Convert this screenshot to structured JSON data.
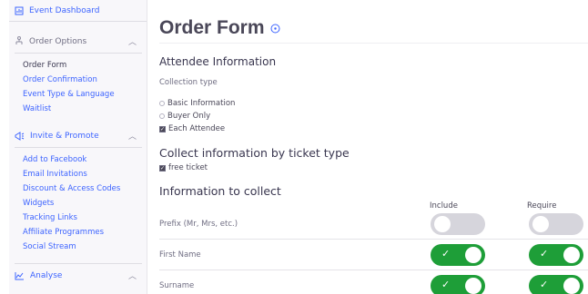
{
  "sidebar": {
    "top_item": "Event Dashboard",
    "order_options": {
      "label": "Order Options",
      "links": [
        "Order Form",
        "Order Confirmation",
        "Event Type & Language",
        "Waitlist"
      ]
    },
    "invite_promote": {
      "label": "Invite & Promote",
      "links": [
        "Add to Facebook",
        "Email Invitations",
        "Discount & Access Codes",
        "Widgets",
        "Tracking Links",
        "Affiliate Programmes",
        "Social Stream"
      ]
    },
    "analyse": {
      "label": "Analyse"
    }
  },
  "main": {
    "title": "Order Form",
    "attendee_info": {
      "heading": "Attendee Information",
      "collection_label": "Collection type",
      "options": [
        "Basic Information",
        "Buyer Only",
        "Each Attendee"
      ],
      "selected": "Each Attendee"
    },
    "ticket_type": {
      "heading": "Collect information by ticket type",
      "ticket_label": "free ticket"
    },
    "collect": {
      "heading": "Information to collect",
      "include_label": "Include",
      "require_label": "Require",
      "rows": [
        {
          "label": "Prefix (Mr, Mrs, etc.)",
          "include": false,
          "require": false
        },
        {
          "label": "First Name",
          "include": true,
          "require": true
        },
        {
          "label": "Surname",
          "include": true,
          "require": true
        }
      ]
    }
  },
  "colors": {
    "accent": "#3d64ff",
    "toggle_on": "#1e9e38",
    "toggle_off": "#d6d5dc"
  }
}
